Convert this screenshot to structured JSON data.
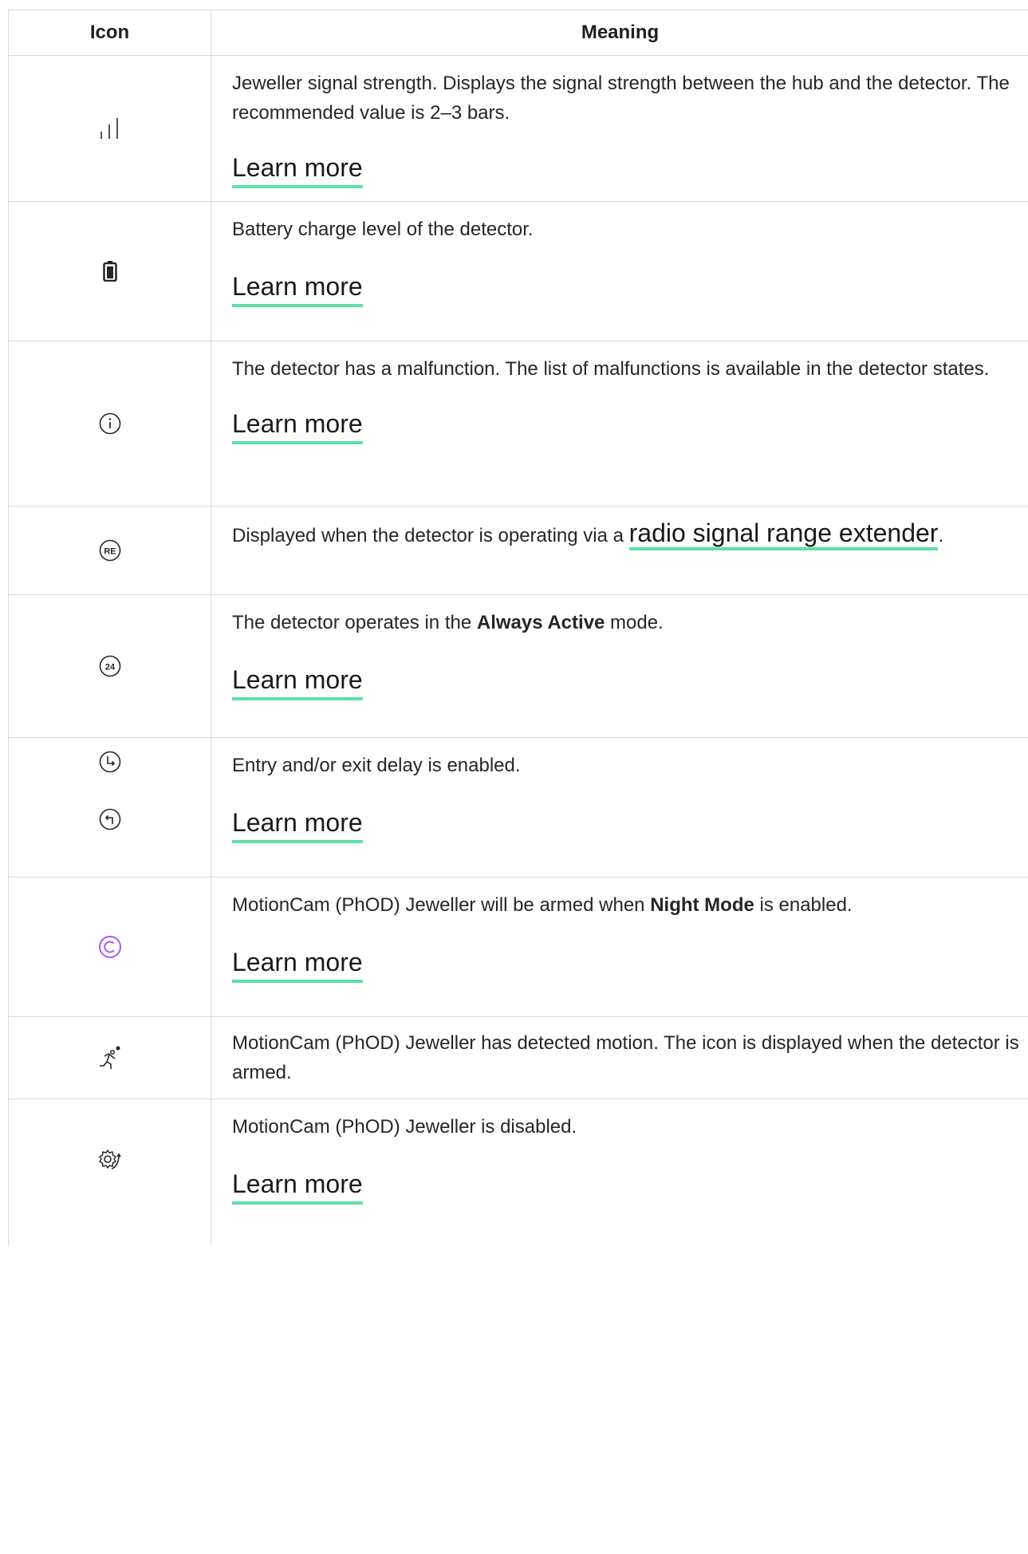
{
  "table": {
    "header": {
      "icon": "Icon",
      "meaning": "Meaning"
    },
    "rows": [
      {
        "icon": "signal-strength-icon",
        "text": "Jeweller signal strength. Displays the signal strength between the hub and the detector. The recommended value is 2–3 bars.",
        "link": "Learn more"
      },
      {
        "icon": "battery-icon",
        "text": "Battery charge level of the detector.",
        "link": "Learn more"
      },
      {
        "icon": "info-icon",
        "text": "The detector has a malfunction. The list of malfunctions is available in the detector states.",
        "link": "Learn more"
      },
      {
        "icon": "range-extender-icon",
        "icon_label": "RE",
        "text_before": "Displayed when the detector is operating via a ",
        "link": "radio signal range extender",
        "text_after": "."
      },
      {
        "icon": "always-active-icon",
        "icon_label": "24",
        "text_before": "The detector operates in the ",
        "bold": "Always Active",
        "text_after": " mode.",
        "link": "Learn more"
      },
      {
        "icon": "delay-icons",
        "text": "Entry and/or exit delay is enabled.",
        "link": "Learn more"
      },
      {
        "icon": "night-mode-icon",
        "icon_color": "#a45cf2",
        "text_before": "MotionCam (PhOD) Jeweller will be armed when ",
        "bold": "Night Mode",
        "text_after": " is enabled.",
        "link": "Learn more"
      },
      {
        "icon": "motion-detected-icon",
        "text": "MotionCam (PhOD) Jeweller has detected motion. The icon is displayed when the detector is armed."
      },
      {
        "icon": "disabled-gear-icon",
        "text": "MotionCam (PhOD) Jeweller is disabled.",
        "link": "Learn more"
      }
    ]
  },
  "colors": {
    "link_underline": "#5fe0a5",
    "border": "#d9d9d9",
    "text": "#262626"
  }
}
